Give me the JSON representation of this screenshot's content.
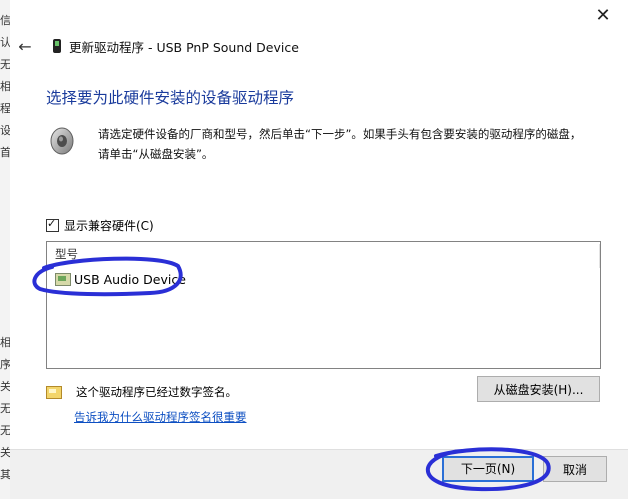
{
  "background_window": {
    "fragments": [
      "信",
      "认",
      "无",
      "相",
      "程",
      "设",
      "首",
      "相",
      "序",
      "关",
      "无",
      "无",
      "关",
      "其"
    ]
  },
  "window": {
    "close_symbol": "✕",
    "back_symbol": "←",
    "title": "更新驱动程序 - USB PnP Sound Device"
  },
  "heading": "选择要为此硬件安装的设备驱动程序",
  "instructions": {
    "line1": "请选定硬件设备的厂商和型号，然后单击“下一步”。如果手头有包含要安装的驱动程序的磁盘，",
    "line2": "请单击“从磁盘安装”。"
  },
  "compat_checkbox": {
    "label": "显示兼容硬件(C)",
    "checked": true
  },
  "model_list": {
    "header": "型号",
    "items": [
      {
        "label": "USB Audio Device",
        "selected": false
      }
    ]
  },
  "signature": {
    "text": "这个驱动程序已经过数字签名。",
    "link": "告诉我为什么驱动程序签名很重要"
  },
  "buttons": {
    "have_disk": "从磁盘安装(H)...",
    "next": "下一页(N)",
    "cancel": "取消"
  },
  "colors": {
    "heading": "#1a3b9c",
    "link": "#0d4fc2",
    "annotation": "#2a2fd6",
    "footer_bg": "#f0f0f0",
    "button_bg": "#e1e1e1"
  }
}
